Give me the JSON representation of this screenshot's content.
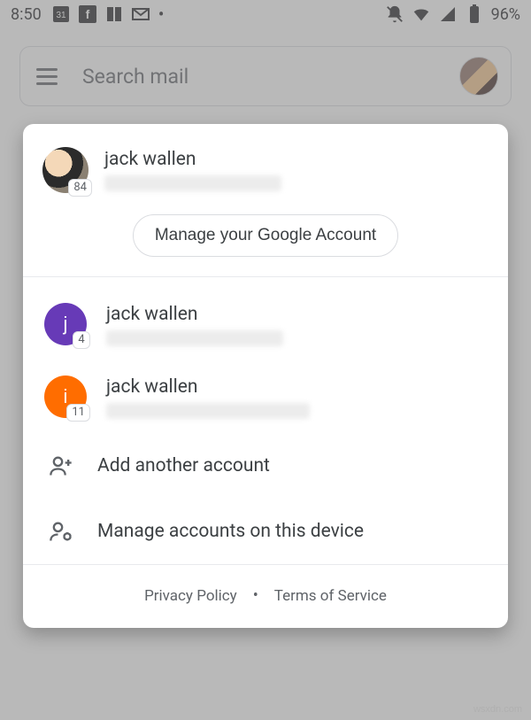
{
  "status": {
    "time": "8:50",
    "battery": "96%",
    "calendar_day": "31"
  },
  "search": {
    "placeholder": "Search mail"
  },
  "primary_account": {
    "name": "jack wallen",
    "badge": "84"
  },
  "manage_button": "Manage your Google Account",
  "other_accounts": [
    {
      "name": "jack wallen",
      "initial": "j",
      "badge": "4",
      "color": "purple"
    },
    {
      "name": "jack wallen",
      "initial": "i",
      "badge": "11",
      "color": "orange"
    }
  ],
  "actions": {
    "add": "Add another account",
    "manage_device": "Manage accounts on this device"
  },
  "footer": {
    "privacy": "Privacy Policy",
    "terms": "Terms of Service"
  },
  "watermark": "wsxdn.com"
}
